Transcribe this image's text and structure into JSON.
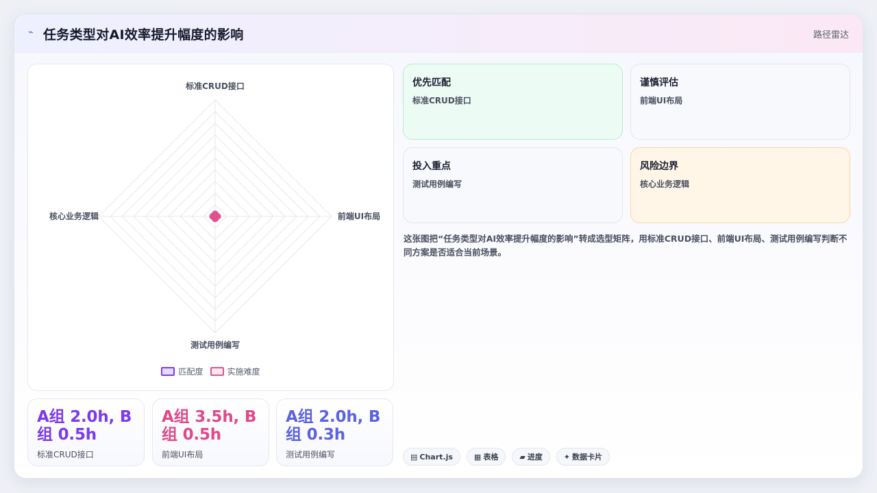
{
  "header": {
    "icon": "line-chart-icon",
    "title": "任务类型对AI效率提升幅度的影响",
    "tag": "路径雷达"
  },
  "chart_data": {
    "type": "radar",
    "axes": [
      "标准CRUD接口",
      "前端UI布局",
      "测试用例编写",
      "核心业务逻辑"
    ],
    "series": [
      {
        "name": "匹配度",
        "color": "#7c3aed",
        "values": [
          0.2,
          0.2,
          0.2,
          0.2
        ]
      },
      {
        "name": "实施难度",
        "color": "#e0528f",
        "values": [
          0.2,
          0.2,
          0.2,
          0.2
        ]
      }
    ],
    "rings": 10,
    "rmax": 10,
    "legend_position": "bottom"
  },
  "stats": [
    {
      "value": "A组 2.0h, B组 0.5h",
      "label": "标准CRUD接口",
      "color": "#7c3aed"
    },
    {
      "value": "A组 3.5h, B组 0.5h",
      "label": "前端UI布局",
      "color": "#e0498a"
    },
    {
      "value": "A组 2.0h, B组 0.3h",
      "label": "测试用例编写",
      "color": "#5b63e0"
    }
  ],
  "matrix": [
    {
      "title": "优先匹配",
      "item": "标准CRUD接口",
      "bg": "#ecfbf4",
      "border": "#b9ecd2"
    },
    {
      "title": "谨慎评估",
      "item": "前端UI布局",
      "bg": "#f8f9fc",
      "border": "#e3e6ef"
    },
    {
      "title": "投入重点",
      "item": "测试用例编写",
      "bg": "#f8f9fc",
      "border": "#e3e6ef"
    },
    {
      "title": "风险边界",
      "item": "核心业务逻辑",
      "bg": "#fff6e8",
      "border": "#f6d9a8"
    }
  ],
  "description": "这张图把“任务类型对AI效率提升幅度的影响”转成选型矩阵，用标准CRUD接口、前端UI布局、测试用例编写判断不同方案是否适合当前场景。",
  "chips": [
    {
      "icon": "▤",
      "label": "Chart.js"
    },
    {
      "icon": "▦",
      "label": "表格"
    },
    {
      "icon": "▰",
      "label": "进度"
    },
    {
      "icon": "✦",
      "label": "数据卡片"
    }
  ]
}
